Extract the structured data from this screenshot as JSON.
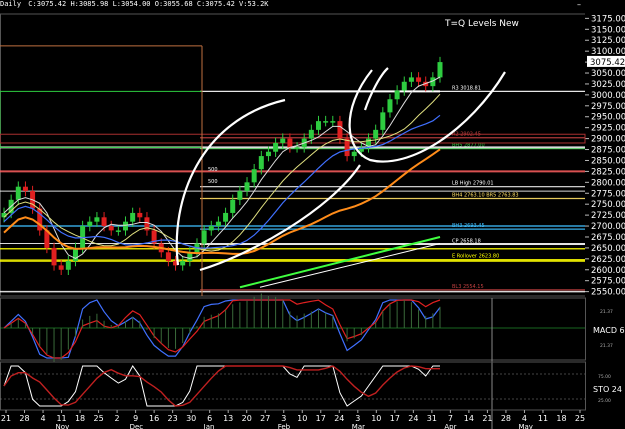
{
  "header": {
    "symbol_period": "Daily",
    "ohlc_line": "C:3075.42 H:3085.98 L:3054.00 O:3055.68 C:3075.42 V:53.2K"
  },
  "window_controls": {
    "minimize": "–",
    "maximize": "□",
    "close": "×"
  },
  "annotation_title": "T=Q Levels New",
  "price_axis": {
    "ticks": [
      "3175.00",
      "3150.00",
      "3125.00",
      "3100.00",
      "3075.00",
      "3050.00",
      "3025.00",
      "3000.00",
      "2975.00",
      "2950.00",
      "2925.00",
      "2900.00",
      "2875.00",
      "2850.00",
      "2825.00",
      "2800.00",
      "2775.00",
      "2750.00",
      "2725.00",
      "2700.00",
      "2675.00",
      "2650.00",
      "2625.00",
      "2600.00",
      "2575.00",
      "2550.00"
    ],
    "current_price": "3075.42"
  },
  "date_axis": {
    "days": [
      "21",
      "28",
      "4",
      "11",
      "18",
      "25",
      "2",
      "9",
      "16",
      "23",
      "30",
      "6",
      "13",
      "20",
      "27",
      "3",
      "10",
      "17",
      "24",
      "3",
      "10",
      "17",
      "24",
      "31",
      "7",
      "14",
      "21",
      "28",
      "4",
      "11",
      "18",
      "25"
    ],
    "months": [
      "Nov",
      "Dec",
      "Jan",
      "Feb",
      "Mar",
      "Apr",
      "May"
    ]
  },
  "levels": [
    {
      "label": "R3 3018.81",
      "price": 3008,
      "color": "#ffffff"
    },
    {
      "label": "R2 2902.45",
      "price": 2902,
      "color": "#c04040"
    },
    {
      "label": "BH5 2877.00",
      "price": 2877,
      "color": "#2ecc40"
    },
    {
      "label": "LB High 2790.01",
      "price": 2790,
      "color": "#ffffff"
    },
    {
      "label": "BH4 2763.10 BR5 2763.83",
      "price": 2763,
      "color": "#ffe066"
    },
    {
      "label": "BH3 2693.45",
      "price": 2693,
      "color": "#40c0ff"
    },
    {
      "label": "CP 2658.18",
      "price": 2658,
      "color": "#ffffff"
    },
    {
      "label": "E Rollover 2623.80",
      "price": 2623,
      "color": "#ffff00"
    },
    {
      "label": "BL3 2554.15",
      "price": 2554,
      "color": "#c04040"
    }
  ],
  "fib_labels": [
    "500",
    "500"
  ],
  "macd_panel": {
    "label": "MACD 6",
    "tick_top": "21.37",
    "tick_bottom": "21.37"
  },
  "sto_panel": {
    "label": "STO 24",
    "tick_top": "75.00",
    "tick_bottom": "25.00"
  },
  "colors": {
    "up": "#2ecc40",
    "down": "#e02020",
    "ma_orange": "#ff8c1a",
    "ma_blue": "#4070ff",
    "ma_white": "#dddddd",
    "ma_yellow": "#e0e080",
    "channel_green": "#40ff40"
  },
  "chart_data": {
    "type": "line",
    "title": "T=Q Levels New",
    "xlabel": "",
    "ylabel": "",
    "ylim": [
      2540,
      3185
    ],
    "series": [
      {
        "values": [
          2730,
          2760,
          2790,
          2780,
          2740,
          2690,
          2650,
          2610,
          2600,
          2620,
          2650,
          2700,
          2710,
          2720,
          2700,
          2690,
          2690,
          2710,
          2730,
          2720,
          2690,
          2660,
          2640,
          2620,
          2610,
          2620,
          2640,
          2660,
          2690,
          2700,
          2710,
          2730,
          2760,
          2780,
          2800,
          2830,
          2860,
          2870,
          2890,
          2900,
          2880,
          2880,
          2900,
          2920,
          2940,
          2940,
          2940,
          2900,
          2860,
          2870,
          2880,
          2900,
          2920,
          2960,
          2990,
          3010,
          3030,
          3040,
          3030,
          3020,
          3040,
          3075
        ]
      }
    ]
  }
}
